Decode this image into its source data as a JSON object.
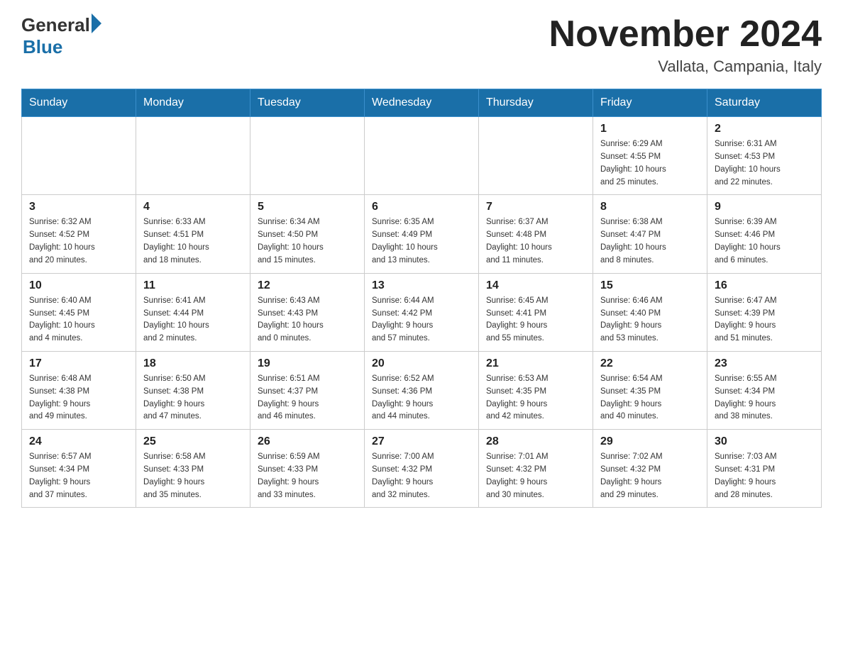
{
  "logo": {
    "general_text": "General",
    "blue_text": "Blue"
  },
  "header": {
    "month_year": "November 2024",
    "location": "Vallata, Campania, Italy"
  },
  "weekdays": [
    "Sunday",
    "Monday",
    "Tuesday",
    "Wednesday",
    "Thursday",
    "Friday",
    "Saturday"
  ],
  "rows": [
    [
      {
        "day": "",
        "info": ""
      },
      {
        "day": "",
        "info": ""
      },
      {
        "day": "",
        "info": ""
      },
      {
        "day": "",
        "info": ""
      },
      {
        "day": "",
        "info": ""
      },
      {
        "day": "1",
        "info": "Sunrise: 6:29 AM\nSunset: 4:55 PM\nDaylight: 10 hours\nand 25 minutes."
      },
      {
        "day": "2",
        "info": "Sunrise: 6:31 AM\nSunset: 4:53 PM\nDaylight: 10 hours\nand 22 minutes."
      }
    ],
    [
      {
        "day": "3",
        "info": "Sunrise: 6:32 AM\nSunset: 4:52 PM\nDaylight: 10 hours\nand 20 minutes."
      },
      {
        "day": "4",
        "info": "Sunrise: 6:33 AM\nSunset: 4:51 PM\nDaylight: 10 hours\nand 18 minutes."
      },
      {
        "day": "5",
        "info": "Sunrise: 6:34 AM\nSunset: 4:50 PM\nDaylight: 10 hours\nand 15 minutes."
      },
      {
        "day": "6",
        "info": "Sunrise: 6:35 AM\nSunset: 4:49 PM\nDaylight: 10 hours\nand 13 minutes."
      },
      {
        "day": "7",
        "info": "Sunrise: 6:37 AM\nSunset: 4:48 PM\nDaylight: 10 hours\nand 11 minutes."
      },
      {
        "day": "8",
        "info": "Sunrise: 6:38 AM\nSunset: 4:47 PM\nDaylight: 10 hours\nand 8 minutes."
      },
      {
        "day": "9",
        "info": "Sunrise: 6:39 AM\nSunset: 4:46 PM\nDaylight: 10 hours\nand 6 minutes."
      }
    ],
    [
      {
        "day": "10",
        "info": "Sunrise: 6:40 AM\nSunset: 4:45 PM\nDaylight: 10 hours\nand 4 minutes."
      },
      {
        "day": "11",
        "info": "Sunrise: 6:41 AM\nSunset: 4:44 PM\nDaylight: 10 hours\nand 2 minutes."
      },
      {
        "day": "12",
        "info": "Sunrise: 6:43 AM\nSunset: 4:43 PM\nDaylight: 10 hours\nand 0 minutes."
      },
      {
        "day": "13",
        "info": "Sunrise: 6:44 AM\nSunset: 4:42 PM\nDaylight: 9 hours\nand 57 minutes."
      },
      {
        "day": "14",
        "info": "Sunrise: 6:45 AM\nSunset: 4:41 PM\nDaylight: 9 hours\nand 55 minutes."
      },
      {
        "day": "15",
        "info": "Sunrise: 6:46 AM\nSunset: 4:40 PM\nDaylight: 9 hours\nand 53 minutes."
      },
      {
        "day": "16",
        "info": "Sunrise: 6:47 AM\nSunset: 4:39 PM\nDaylight: 9 hours\nand 51 minutes."
      }
    ],
    [
      {
        "day": "17",
        "info": "Sunrise: 6:48 AM\nSunset: 4:38 PM\nDaylight: 9 hours\nand 49 minutes."
      },
      {
        "day": "18",
        "info": "Sunrise: 6:50 AM\nSunset: 4:38 PM\nDaylight: 9 hours\nand 47 minutes."
      },
      {
        "day": "19",
        "info": "Sunrise: 6:51 AM\nSunset: 4:37 PM\nDaylight: 9 hours\nand 46 minutes."
      },
      {
        "day": "20",
        "info": "Sunrise: 6:52 AM\nSunset: 4:36 PM\nDaylight: 9 hours\nand 44 minutes."
      },
      {
        "day": "21",
        "info": "Sunrise: 6:53 AM\nSunset: 4:35 PM\nDaylight: 9 hours\nand 42 minutes."
      },
      {
        "day": "22",
        "info": "Sunrise: 6:54 AM\nSunset: 4:35 PM\nDaylight: 9 hours\nand 40 minutes."
      },
      {
        "day": "23",
        "info": "Sunrise: 6:55 AM\nSunset: 4:34 PM\nDaylight: 9 hours\nand 38 minutes."
      }
    ],
    [
      {
        "day": "24",
        "info": "Sunrise: 6:57 AM\nSunset: 4:34 PM\nDaylight: 9 hours\nand 37 minutes."
      },
      {
        "day": "25",
        "info": "Sunrise: 6:58 AM\nSunset: 4:33 PM\nDaylight: 9 hours\nand 35 minutes."
      },
      {
        "day": "26",
        "info": "Sunrise: 6:59 AM\nSunset: 4:33 PM\nDaylight: 9 hours\nand 33 minutes."
      },
      {
        "day": "27",
        "info": "Sunrise: 7:00 AM\nSunset: 4:32 PM\nDaylight: 9 hours\nand 32 minutes."
      },
      {
        "day": "28",
        "info": "Sunrise: 7:01 AM\nSunset: 4:32 PM\nDaylight: 9 hours\nand 30 minutes."
      },
      {
        "day": "29",
        "info": "Sunrise: 7:02 AM\nSunset: 4:32 PM\nDaylight: 9 hours\nand 29 minutes."
      },
      {
        "day": "30",
        "info": "Sunrise: 7:03 AM\nSunset: 4:31 PM\nDaylight: 9 hours\nand 28 minutes."
      }
    ]
  ]
}
